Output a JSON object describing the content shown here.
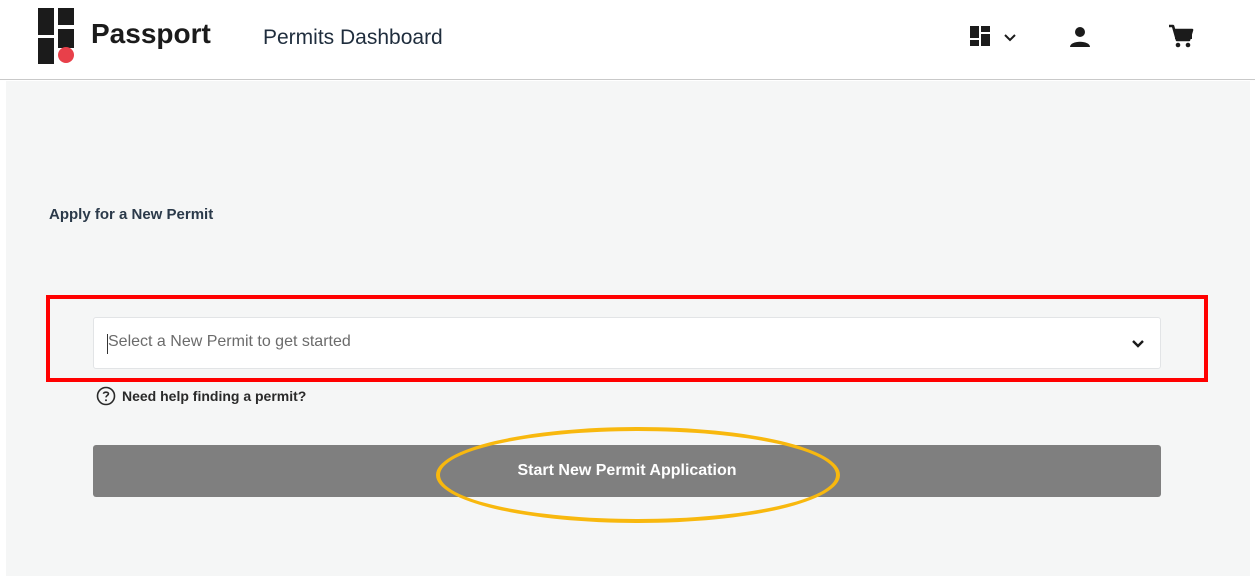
{
  "header": {
    "logo_text": "Passport",
    "page_title": "Permits Dashboard",
    "icons": {
      "logo": "passport-logo-mark",
      "apps": "grid-apps-icon",
      "apps_caret": "chevron-down-icon",
      "user": "user-icon",
      "cart": "shopping-cart-icon"
    }
  },
  "main": {
    "section_heading": "Apply for a New Permit",
    "permit_select": {
      "placeholder": "Select a New Permit to get started",
      "value": ""
    },
    "help_link": "Need help finding a permit?",
    "start_button": "Start New Permit Application"
  },
  "annotations": {
    "rect_color": "#ff0000",
    "ellipse_color": "#f8b80e"
  },
  "colors": {
    "logo_red": "#e8404a",
    "button_gray": "#7f7f7f",
    "background": "#f5f6f6"
  }
}
